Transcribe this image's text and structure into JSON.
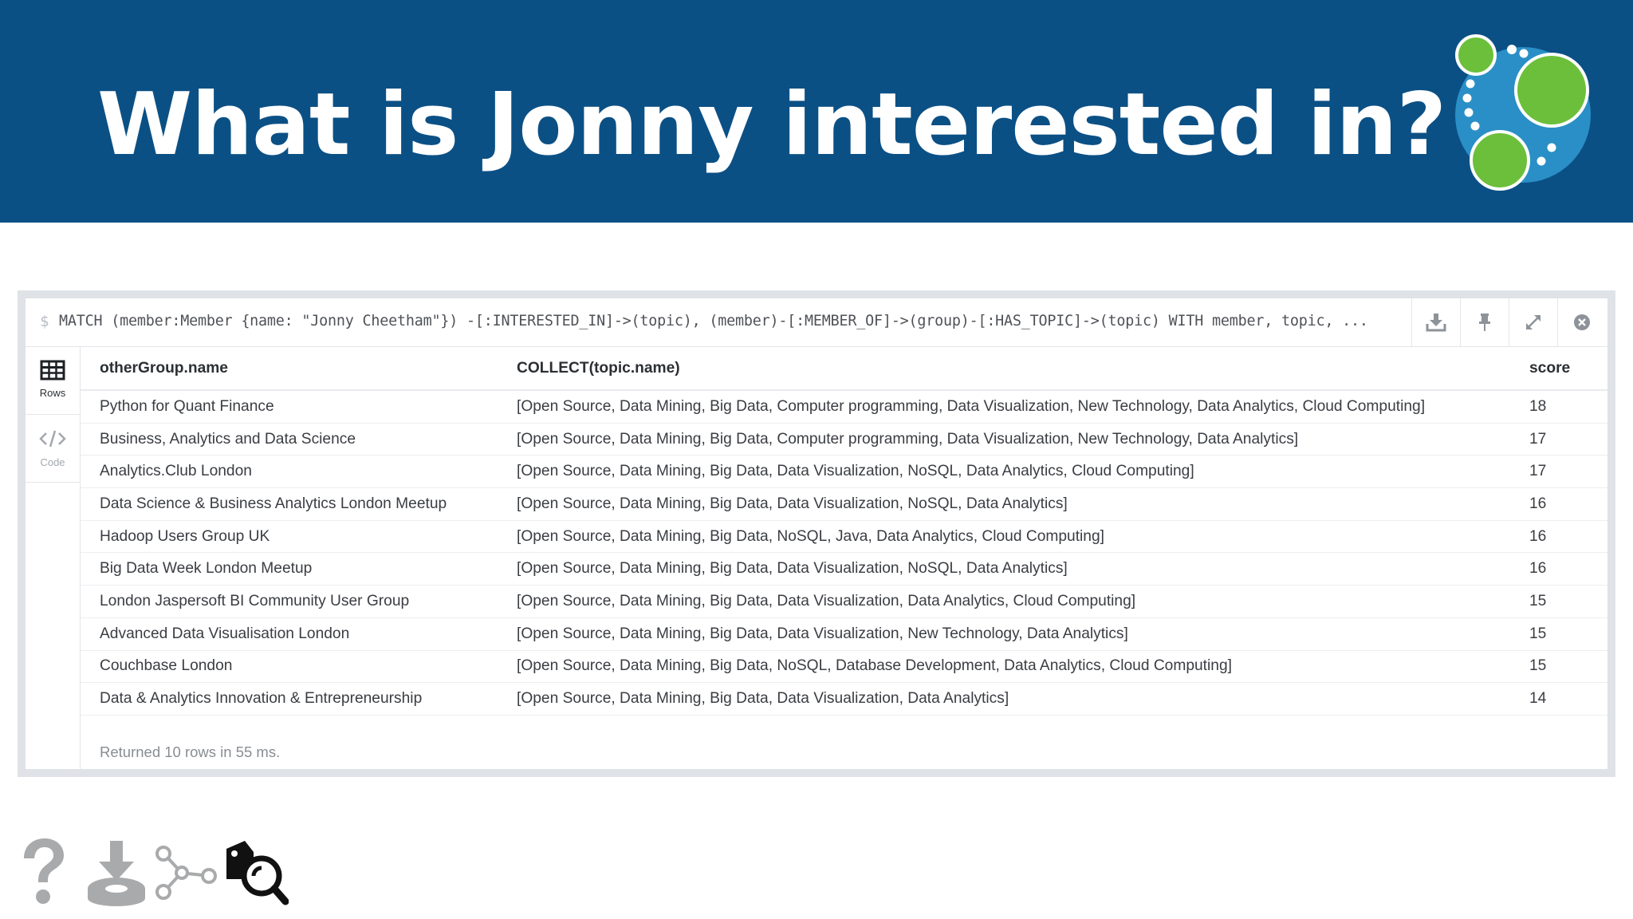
{
  "slide": {
    "title": "What is Jonny interested in?"
  },
  "editor": {
    "prompt": "$",
    "query": "MATCH (member:Member {name: \"Jonny Cheetham\"}) -[:INTERESTED_IN]->(topic), (member)-[:MEMBER_OF]->(group)-[:HAS_TOPIC]->(topic) WITH member, topic, ..."
  },
  "toolbar": {
    "icons": [
      "download-icon",
      "pin-icon",
      "expand-icon",
      "close-icon"
    ]
  },
  "sidenav": {
    "rows_label": "Rows",
    "code_label": "Code"
  },
  "table": {
    "columns": [
      "otherGroup.name",
      "COLLECT(topic.name)",
      "score"
    ],
    "rows": [
      {
        "name": "Python for Quant Finance",
        "topics": "[Open Source, Data Mining, Big Data, Computer programming, Data Visualization, New Technology, Data Analytics, Cloud Computing]",
        "score": "18"
      },
      {
        "name": "Business, Analytics and Data Science",
        "topics": "[Open Source, Data Mining, Big Data, Computer programming, Data Visualization, New Technology, Data Analytics]",
        "score": "17"
      },
      {
        "name": "Analytics.Club London",
        "topics": "[Open Source, Data Mining, Big Data, Data Visualization, NoSQL, Data Analytics, Cloud Computing]",
        "score": "17"
      },
      {
        "name": "Data Science & Business Analytics London Meetup",
        "topics": "[Open Source, Data Mining, Big Data, Data Visualization, NoSQL, Data Analytics]",
        "score": "16"
      },
      {
        "name": "Hadoop Users Group UK",
        "topics": "[Open Source, Data Mining, Big Data, NoSQL, Java, Data Analytics, Cloud Computing]",
        "score": "16"
      },
      {
        "name": "Big Data Week London Meetup",
        "topics": "[Open Source, Data Mining, Big Data, Data Visualization, NoSQL, Data Analytics]",
        "score": "16"
      },
      {
        "name": "London Jaspersoft BI Community User Group",
        "topics": "[Open Source, Data Mining, Big Data, Data Visualization, Data Analytics, Cloud Computing]",
        "score": "15"
      },
      {
        "name": "Advanced Data Visualisation London",
        "topics": "[Open Source, Data Mining, Big Data, Data Visualization, New Technology, Data Analytics]",
        "score": "15"
      },
      {
        "name": "Couchbase London",
        "topics": "[Open Source, Data Mining, Big Data, NoSQL, Database Development, Data Analytics, Cloud Computing]",
        "score": "15"
      },
      {
        "name": "Data & Analytics Innovation & Entrepreneurship",
        "topics": "[Open Source, Data Mining, Big Data, Data Visualization, Data Analytics]",
        "score": "14"
      }
    ],
    "status": "Returned 10 rows in 55 ms."
  },
  "bottom_icons": [
    "question-icon",
    "import-icon",
    "graph-path-icon",
    "tag-search-icon"
  ],
  "colors": {
    "banner": "#0b5085",
    "logo_blue": "#2a8fc6",
    "logo_green": "#6cbf3a"
  }
}
